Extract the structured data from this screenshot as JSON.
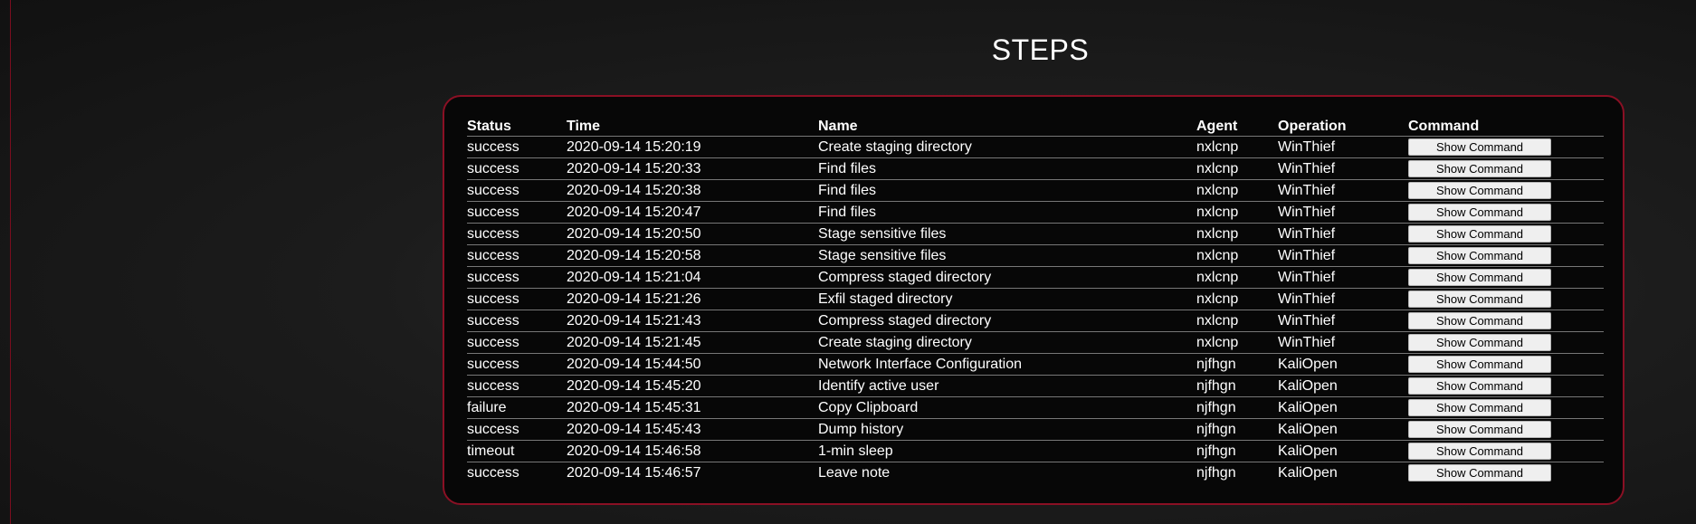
{
  "page": {
    "title": "STEPS"
  },
  "table": {
    "headers": [
      "Status",
      "Time",
      "Name",
      "Agent",
      "Operation",
      "Command"
    ],
    "button_label": "Show Command",
    "rows": [
      {
        "status": "success",
        "time": "2020-09-14 15:20:19",
        "name": "Create staging directory",
        "agent": "nxlcnp",
        "operation": "WinThief"
      },
      {
        "status": "success",
        "time": "2020-09-14 15:20:33",
        "name": "Find files",
        "agent": "nxlcnp",
        "operation": "WinThief"
      },
      {
        "status": "success",
        "time": "2020-09-14 15:20:38",
        "name": "Find files",
        "agent": "nxlcnp",
        "operation": "WinThief"
      },
      {
        "status": "success",
        "time": "2020-09-14 15:20:47",
        "name": "Find files",
        "agent": "nxlcnp",
        "operation": "WinThief"
      },
      {
        "status": "success",
        "time": "2020-09-14 15:20:50",
        "name": "Stage sensitive files",
        "agent": "nxlcnp",
        "operation": "WinThief"
      },
      {
        "status": "success",
        "time": "2020-09-14 15:20:58",
        "name": "Stage sensitive files",
        "agent": "nxlcnp",
        "operation": "WinThief"
      },
      {
        "status": "success",
        "time": "2020-09-14 15:21:04",
        "name": "Compress staged directory",
        "agent": "nxlcnp",
        "operation": "WinThief"
      },
      {
        "status": "success",
        "time": "2020-09-14 15:21:26",
        "name": "Exfil staged directory",
        "agent": "nxlcnp",
        "operation": "WinThief"
      },
      {
        "status": "success",
        "time": "2020-09-14 15:21:43",
        "name": "Compress staged directory",
        "agent": "nxlcnp",
        "operation": "WinThief"
      },
      {
        "status": "success",
        "time": "2020-09-14 15:21:45",
        "name": "Create staging directory",
        "agent": "nxlcnp",
        "operation": "WinThief"
      },
      {
        "status": "success",
        "time": "2020-09-14 15:44:50",
        "name": "Network Interface Configuration",
        "agent": "njfhgn",
        "operation": "KaliOpen"
      },
      {
        "status": "success",
        "time": "2020-09-14 15:45:20",
        "name": "Identify active user",
        "agent": "njfhgn",
        "operation": "KaliOpen"
      },
      {
        "status": "failure",
        "time": "2020-09-14 15:45:31",
        "name": "Copy Clipboard",
        "agent": "njfhgn",
        "operation": "KaliOpen"
      },
      {
        "status": "success",
        "time": "2020-09-14 15:45:43",
        "name": "Dump history",
        "agent": "njfhgn",
        "operation": "KaliOpen"
      },
      {
        "status": "timeout",
        "time": "2020-09-14 15:46:58",
        "name": "1-min sleep",
        "agent": "njfhgn",
        "operation": "KaliOpen"
      },
      {
        "status": "success",
        "time": "2020-09-14 15:46:57",
        "name": "Leave note",
        "agent": "njfhgn",
        "operation": "KaliOpen"
      }
    ]
  },
  "colors": {
    "accent": "#8a1024",
    "background": "#1c1c1c",
    "panel": "#070707"
  }
}
